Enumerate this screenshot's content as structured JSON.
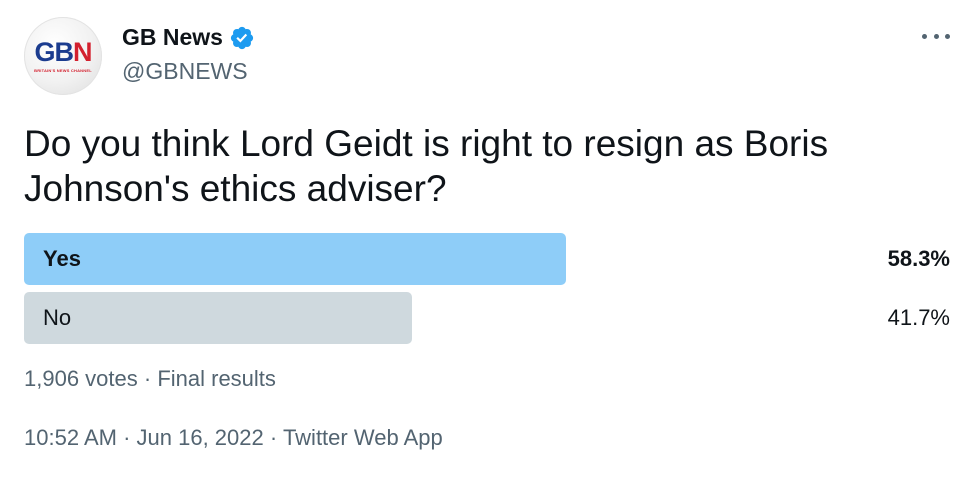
{
  "account": {
    "display_name": "GB News",
    "handle": "@GBNEWS",
    "avatar_logo_main": "GB",
    "avatar_logo_accent": "N",
    "avatar_logo_sub": "BRITAIN'S NEWS CHANNEL",
    "verified_icon": "verified-badge-icon",
    "more_icon": "more-options-icon"
  },
  "tweet": {
    "text": "Do you think Lord Geidt is right to resign as Boris Johnson's ethics adviser?"
  },
  "poll": {
    "options": [
      {
        "label": "Yes",
        "percent_text": "58.3%",
        "fraction": 0.583,
        "winner": true
      },
      {
        "label": "No",
        "percent_text": "41.7%",
        "fraction": 0.417,
        "winner": false
      }
    ],
    "votes": "1,906 votes",
    "separator": "·",
    "status": "Final results"
  },
  "meta": {
    "time": "10:52 AM",
    "separator": "·",
    "date": "Jun 16, 2022",
    "source": "Twitter Web App"
  },
  "colors": {
    "winner_bar": "#8ecdf8",
    "other_bar": "#cfd9de",
    "brand_blue": "#1d9bf0",
    "secondary_text": "#536471"
  }
}
